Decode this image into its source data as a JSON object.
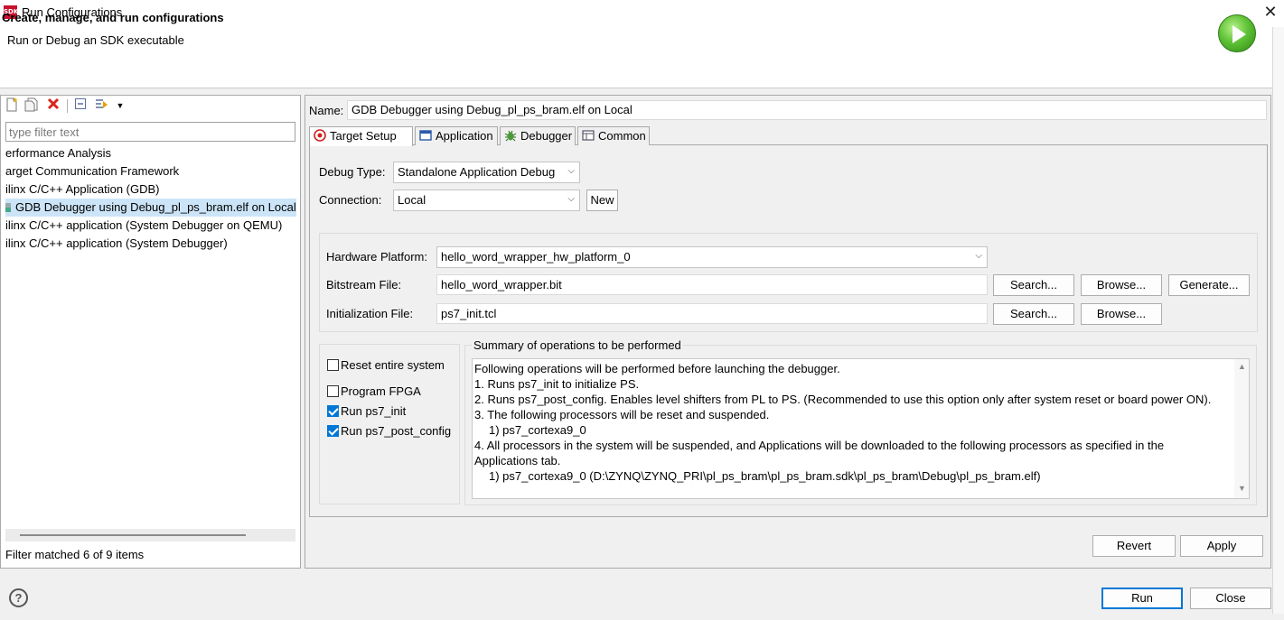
{
  "window": {
    "title": "Run Configurations",
    "app_icon_text": "SDK"
  },
  "banner": {
    "title": "Create, manage, and run configurations",
    "subtitle": "Run or Debug an SDK executable"
  },
  "left": {
    "filter_placeholder": "type filter text",
    "items": [
      {
        "label": "erformance Analysis"
      },
      {
        "label": "arget Communication Framework"
      },
      {
        "label": "ilinx C/C++ Application (GDB)"
      },
      {
        "label": "GDB Debugger using Debug_pl_ps_bram.elf on Local",
        "selected": true
      },
      {
        "label": "ilinx C/C++ application (System Debugger on QEMU)"
      },
      {
        "label": "ilinx C/C++ application (System Debugger)"
      }
    ],
    "status": "Filter matched 6 of 9 items"
  },
  "right": {
    "name_label": "Name:",
    "name_value": "GDB Debugger using Debug_pl_ps_bram.elf on Local",
    "tabs": [
      {
        "label": "Target Setup",
        "icon": "target-icon",
        "active": true
      },
      {
        "label": "Application",
        "icon": "application-icon"
      },
      {
        "label": "Debugger",
        "icon": "bug-icon"
      },
      {
        "label": "Common",
        "icon": "common-icon"
      }
    ],
    "debug_type_label": "Debug Type:",
    "debug_type_value": "Standalone Application Debug",
    "connection_label": "Connection:",
    "connection_value": "Local",
    "new_label": "New",
    "hw_platform_label": "Hardware Platform:",
    "hw_platform_value": "hello_word_wrapper_hw_platform_0",
    "bitstream_label": "Bitstream File:",
    "bitstream_value": "hello_word_wrapper.bit",
    "init_label": "Initialization File:",
    "init_value": "ps7_init.tcl",
    "search_label": "Search...",
    "browse_label": "Browse...",
    "generate_label": "Generate...",
    "checks": [
      {
        "label": "Reset entire system",
        "checked": false
      },
      {
        "label": "Program FPGA",
        "checked": false
      },
      {
        "label": "Run ps7_init",
        "checked": true
      },
      {
        "label": "Run ps7_post_config",
        "checked": true
      }
    ],
    "summary_title": "Summary of operations to be performed",
    "summary_lines": [
      "Following operations will be performed before launching the debugger.",
      "1. Runs ps7_init to initialize PS.",
      "2. Runs ps7_post_config. Enables level shifters from PL to PS. (Recommended to use this option only after system reset or board power ON).",
      "3. The following processors will be reset and suspended.",
      "1) ps7_cortexa9_0",
      "4. All processors in the system will be suspended, and Applications will be downloaded to the following processors as specified in the",
      "Applications tab.",
      "1) ps7_cortexa9_0 (D:\\ZYNQ\\ZYNQ_PRI\\pl_ps_bram\\pl_ps_bram.sdk\\pl_ps_bram\\Debug\\pl_ps_bram.elf)"
    ],
    "revert_label": "Revert",
    "apply_label": "Apply"
  },
  "footer": {
    "run_label": "Run",
    "close_label": "Close",
    "help_glyph": "?"
  }
}
